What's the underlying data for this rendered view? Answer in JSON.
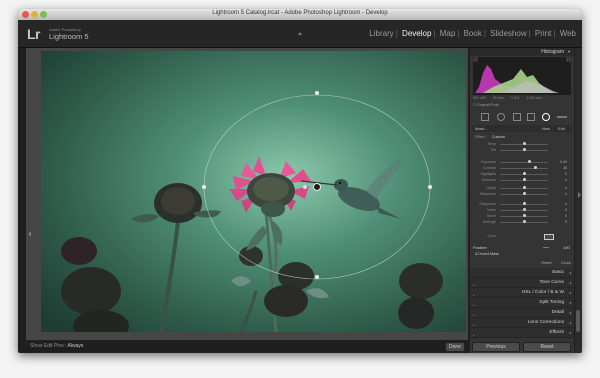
{
  "window": {
    "title": "Lightroom 5 Catalog.lrcat - Adobe Photoshop Lightroom - Develop"
  },
  "identity": {
    "logo": "Lr",
    "vendor": "Adobe Photoshop",
    "product": "Lightroom 5"
  },
  "modules": [
    "Library",
    "Develop",
    "Map",
    "Book",
    "Slideshow",
    "Print",
    "Web"
  ],
  "active_module": "Develop",
  "histogram": {
    "title": "Histogram",
    "meta": [
      "ISO 400",
      "90 mm",
      "f / 5.6",
      "1/160 sec"
    ],
    "original_label": "Original Photo"
  },
  "mask": {
    "label": "Mask :",
    "new": "New",
    "edit": "Edit"
  },
  "effect": {
    "label": "Effect :",
    "value": "Custom"
  },
  "sliders": [
    {
      "label": "Temp",
      "value": ""
    },
    {
      "label": "Tint",
      "value": ""
    },
    {
      "label": "Exposure",
      "value": "0.49"
    },
    {
      "label": "Contrast",
      "value": "38"
    },
    {
      "label": "Highlights",
      "value": "0"
    },
    {
      "label": "Shadows",
      "value": "0"
    },
    {
      "label": "Clarity",
      "value": "0"
    },
    {
      "label": "Saturation",
      "value": "0"
    },
    {
      "label": "Sharpness",
      "value": "0"
    },
    {
      "label": "Noise",
      "value": "0"
    },
    {
      "label": "Moiré",
      "value": "0"
    },
    {
      "label": "Defringe",
      "value": "0"
    },
    {
      "label": "Color",
      "value": ""
    }
  ],
  "feather": {
    "label": "Feather",
    "value": "100",
    "invert_label": "Invert Mask"
  },
  "panel_actions": {
    "reset": "Reset",
    "close": "Close"
  },
  "sections": [
    "Basic",
    "Tone Curve",
    "HSL / Color / B & W",
    "Split Toning",
    "Detail",
    "Lens Corrections",
    "Effects"
  ],
  "bottombar": {
    "show_edit_prefix": "Show Edit Pins :",
    "show_edit_value": "Always",
    "done": "Done"
  },
  "nav": {
    "previous": "Previous",
    "reset": "Reset"
  },
  "colors": {
    "accent": "#f2f2f2",
    "photo_green": "#3c6a58",
    "flower_pink": "#e0508e"
  }
}
